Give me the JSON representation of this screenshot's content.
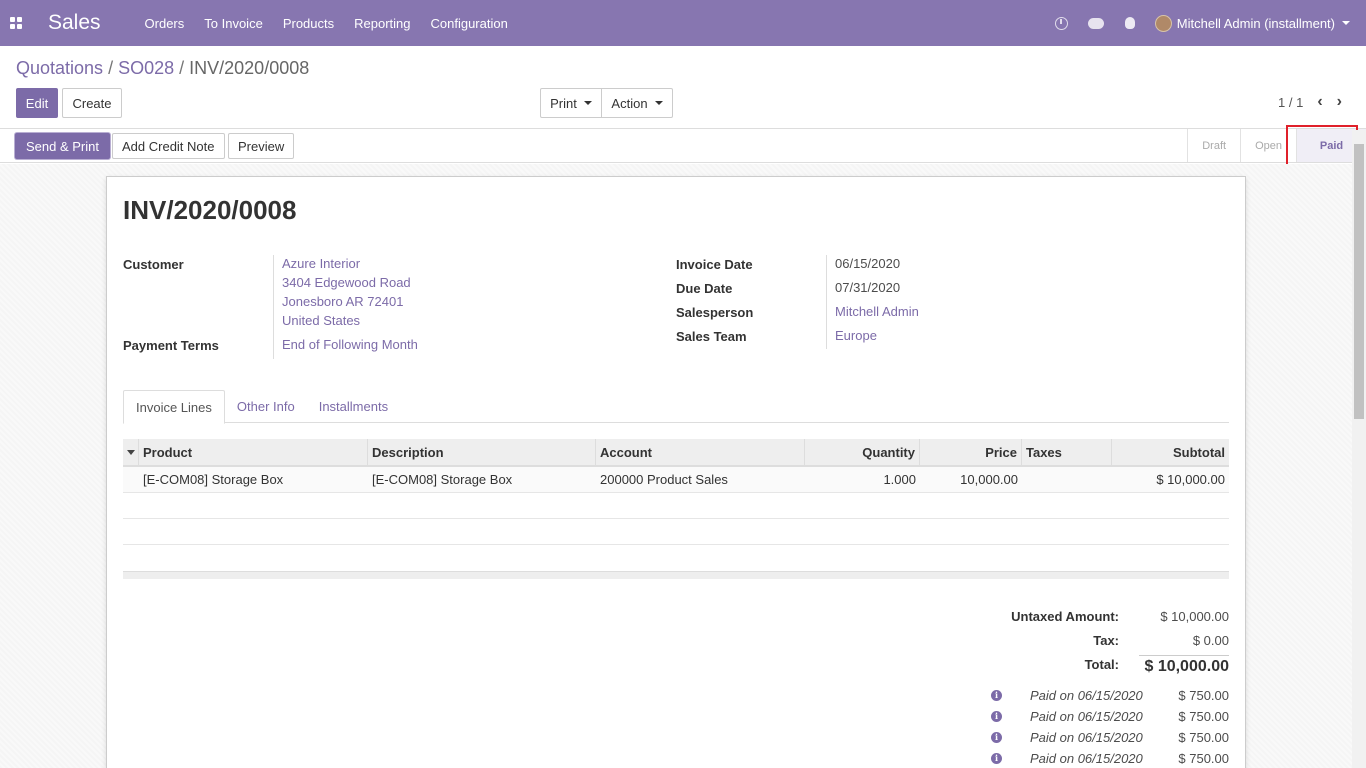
{
  "navbar": {
    "app_name": "Sales",
    "menu": [
      "Orders",
      "To Invoice",
      "Products",
      "Reporting",
      "Configuration"
    ],
    "icons": [
      "clock-icon",
      "chat-icon",
      "bug-icon"
    ],
    "user": "Mitchell Admin (installment)"
  },
  "breadcrumb": {
    "root": "Quotations",
    "mid": "SO028",
    "current": "INV/2020/0008"
  },
  "buttons": {
    "edit": "Edit",
    "create": "Create",
    "print": "Print",
    "action": "Action"
  },
  "pager": {
    "value": "1 / 1"
  },
  "statusbar": {
    "send_print": "Send & Print",
    "add_credit_note": "Add Credit Note",
    "preview": "Preview",
    "stages": [
      "Draft",
      "Open",
      "Paid"
    ],
    "active_stage": "Paid"
  },
  "invoice": {
    "number": "INV/2020/0008",
    "customer_label": "Customer",
    "customer": [
      "Azure Interior",
      "3404 Edgewood Road",
      "Jonesboro AR 72401",
      "United States"
    ],
    "payment_terms_label": "Payment Terms",
    "payment_terms": "End of Following Month",
    "invoice_date_label": "Invoice Date",
    "invoice_date": "06/15/2020",
    "due_date_label": "Due Date",
    "due_date": "07/31/2020",
    "salesperson_label": "Salesperson",
    "salesperson": "Mitchell Admin",
    "sales_team_label": "Sales Team",
    "sales_team": "Europe"
  },
  "tabs": [
    "Invoice Lines",
    "Other Info",
    "Installments"
  ],
  "table": {
    "headers": [
      "Product",
      "Description",
      "Account",
      "Quantity",
      "Price",
      "Taxes",
      "Subtotal"
    ],
    "rows": [
      {
        "product": "[E-COM08] Storage Box",
        "description": "[E-COM08] Storage Box",
        "account": "200000 Product Sales",
        "quantity": "1.000",
        "price": "10,000.00",
        "taxes": "",
        "subtotal": "$ 10,000.00"
      }
    ]
  },
  "totals": {
    "untaxed_label": "Untaxed Amount:",
    "untaxed": "$ 10,000.00",
    "tax_label": "Tax:",
    "tax": "$ 0.00",
    "total_label": "Total:",
    "total": "$ 10,000.00"
  },
  "payments": [
    {
      "text": "Paid on 06/15/2020",
      "amount": "$ 750.00"
    },
    {
      "text": "Paid on 06/15/2020",
      "amount": "$ 750.00"
    },
    {
      "text": "Paid on 06/15/2020",
      "amount": "$ 750.00"
    },
    {
      "text": "Paid on 06/15/2020",
      "amount": "$ 750.00"
    }
  ]
}
